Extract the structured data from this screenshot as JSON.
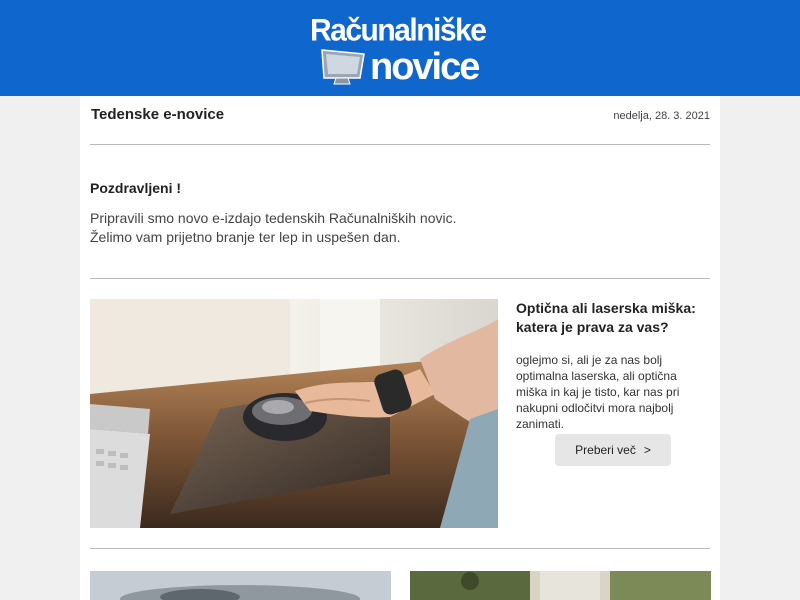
{
  "brand": {
    "logo_line1": "Računalniške",
    "logo_line2": "novice"
  },
  "newsletter": {
    "title": "Tedenske e-novice",
    "date": "nedelja, 28. 3. 2021"
  },
  "greeting": {
    "heading": "Pozdravljeni !",
    "line1": "Pripravili smo novo e-izdajo tedenskih Računalniških novic.",
    "line2": "Želimo vam prijetno branje ter lep in uspešen dan."
  },
  "article": {
    "title": "Optična ali laserska miška: katera je prava za vas?",
    "excerpt": "oglejmo si, ali je za nas bolj optimalna laserska, ali optična miška in kaj je tisto, kar nas pri nakupni odločitvi mora najbolj zanimati.",
    "read_more": "Preberi več",
    "read_more_icon": ">"
  },
  "colors": {
    "header": "#0f66cc",
    "button": "#e6e6e6"
  }
}
